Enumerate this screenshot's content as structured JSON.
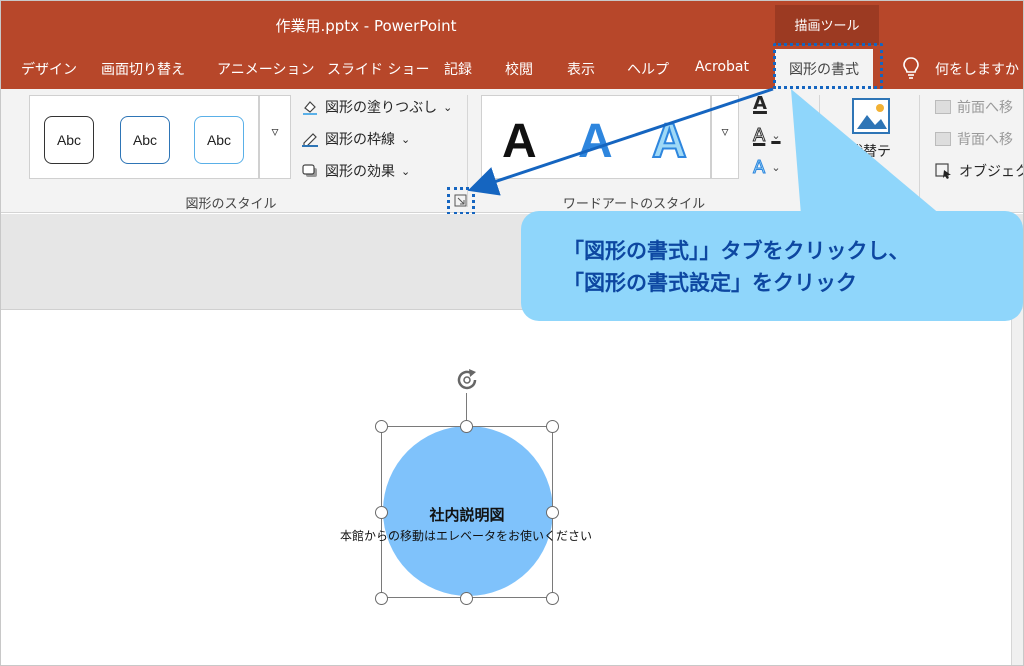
{
  "window": {
    "title": "作業用.pptx  -  PowerPoint",
    "context_tab_group": "描画ツール"
  },
  "tabs": [
    {
      "label": "デザイン"
    },
    {
      "label": "画面切り替え"
    },
    {
      "label": "アニメーション"
    },
    {
      "label": "スライド ショー"
    },
    {
      "label": "記録"
    },
    {
      "label": "校閲"
    },
    {
      "label": "表示"
    },
    {
      "label": "ヘルプ"
    },
    {
      "label": "Acrobat"
    },
    {
      "label": "図形の書式",
      "active": true
    },
    {
      "label": "何をしますか"
    }
  ],
  "ribbon": {
    "shape_styles": {
      "gallery": [
        "Abc",
        "Abc",
        "Abc"
      ],
      "fill": "図形の塗りつぶし",
      "outline": "図形の枠線",
      "effects": "図形の効果",
      "label": "図形のスタイル"
    },
    "wordart_styles": {
      "samples": [
        "A",
        "A",
        "A"
      ],
      "label": "ワードアートのスタイル",
      "text_fill_glyph": "A",
      "text_outline_glyph": "A",
      "text_effect_glyph": "A"
    },
    "accessibility": {
      "alt_text": "代替テ"
    },
    "arrange": {
      "bring_forward": "前面へ移",
      "send_backward": "背面へ移",
      "selection_pane": "オブジェク"
    },
    "more_glyph": "▿",
    "dropdown_glyph": "⌄"
  },
  "slide": {
    "shape_title": "社内説明図",
    "shape_subtitle": "本館からの移動はエレベータをお使いください"
  },
  "callout": {
    "line1": "「図形の書式」」タブをクリックし、",
    "line2": "「図形の書式設定」をクリック"
  },
  "colors": {
    "titlebar": "#b7472a",
    "callout": "#8fd6fb",
    "callout_text": "#0d47a1",
    "annotation": "#1565c0",
    "shape_fill": "#7fc2fb"
  }
}
